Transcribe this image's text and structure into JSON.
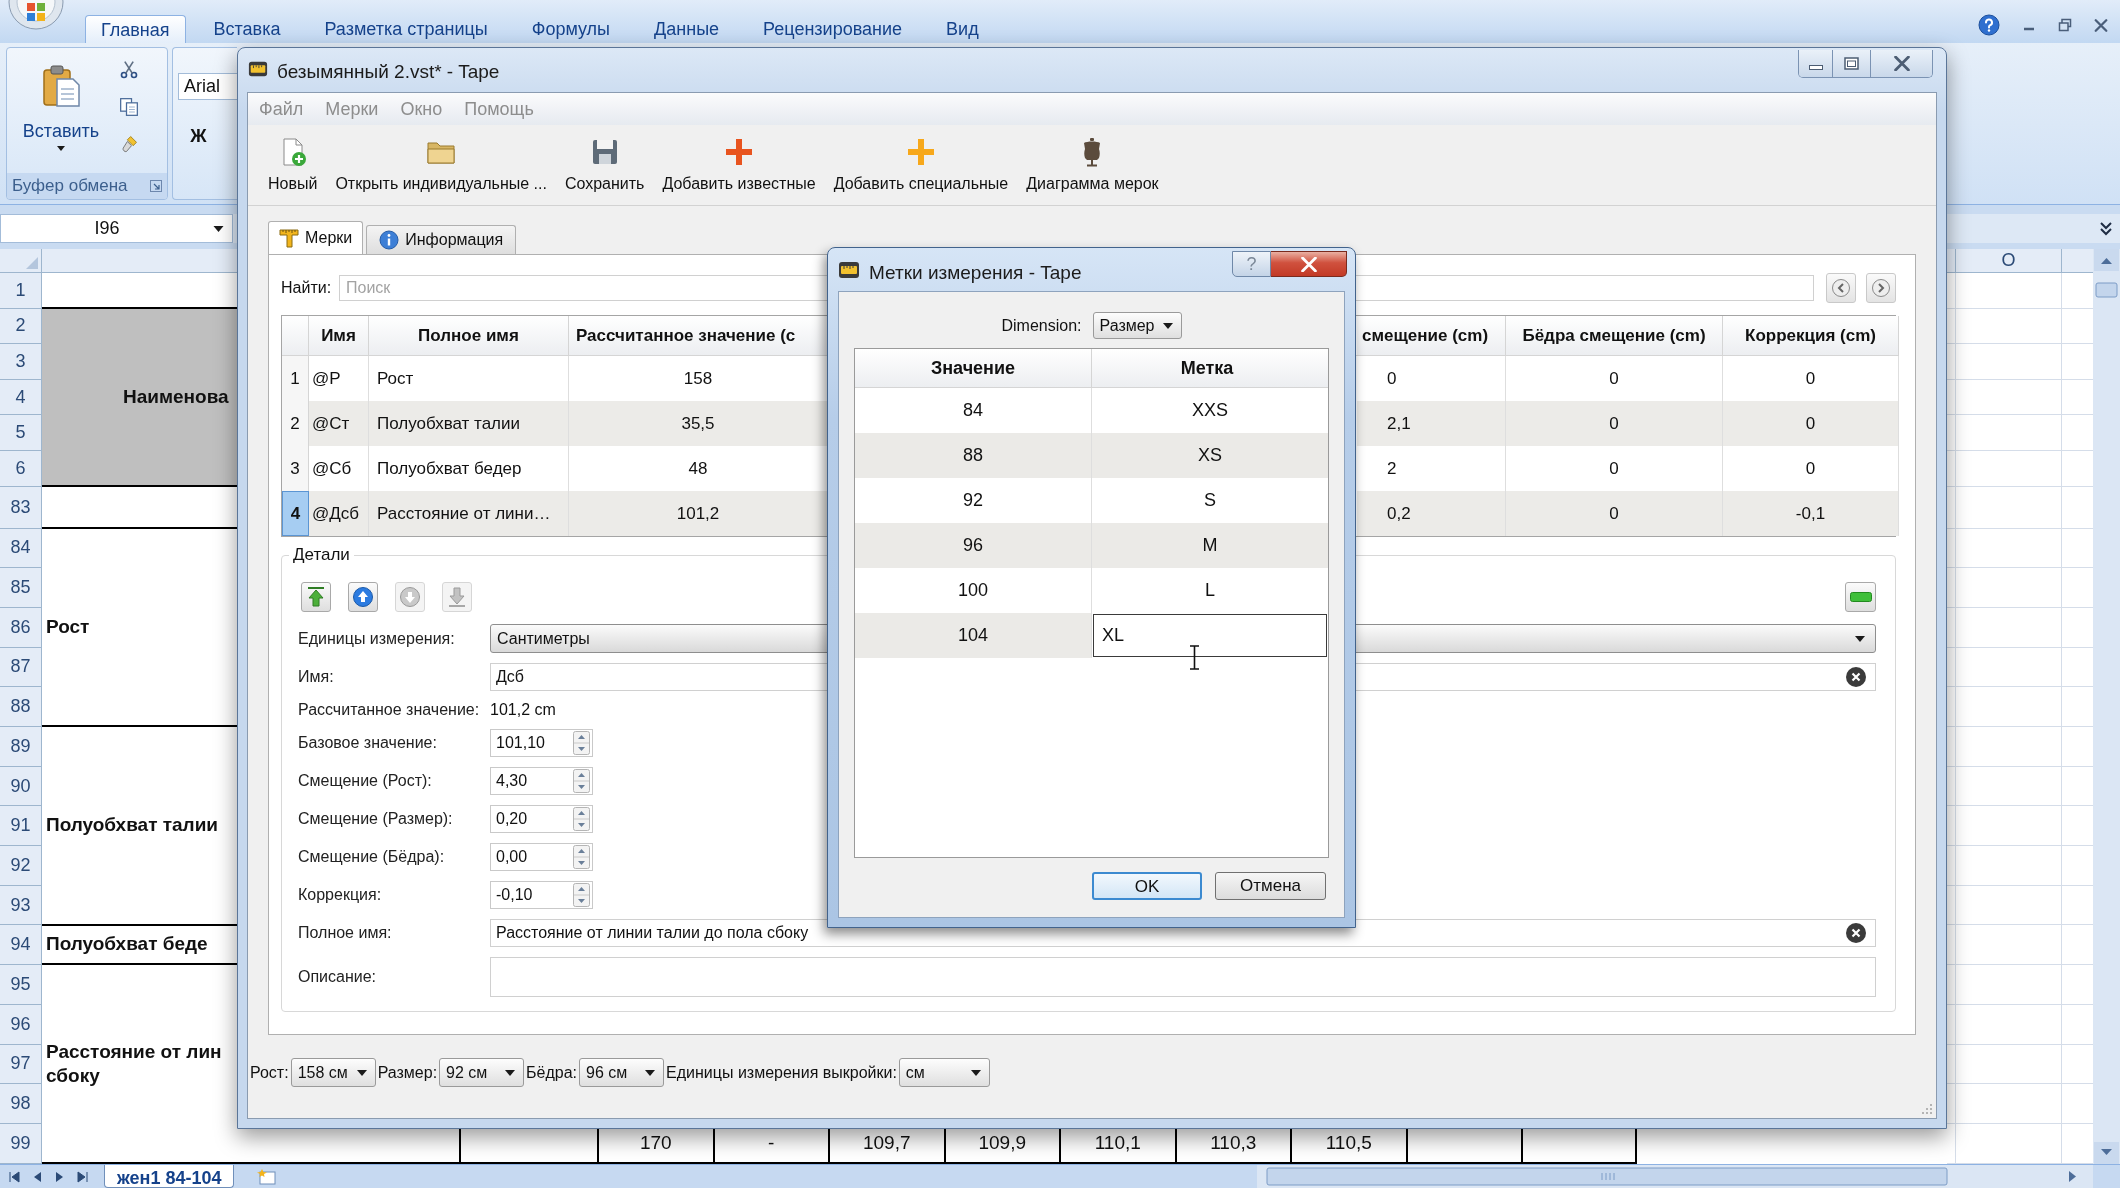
{
  "excel": {
    "ribbon_tabs": [
      {
        "label": "Главная",
        "selected": true
      },
      {
        "label": "Вставка",
        "selected": false
      },
      {
        "label": "Разметка страницы",
        "selected": false
      },
      {
        "label": "Формулы",
        "selected": false
      },
      {
        "label": "Данные",
        "selected": false
      },
      {
        "label": "Рецензирование",
        "selected": false
      },
      {
        "label": "Вид",
        "selected": false
      }
    ],
    "clipboard_group": {
      "paste_label": "Вставить",
      "title": "Буфер обмена"
    },
    "font_group": {
      "font_name": "Arial",
      "bold_label": "Ж"
    },
    "name_box": "I96",
    "column_header": "O",
    "row_groups": [
      {
        "rows": [
          "1"
        ],
        "shaded": false
      },
      {
        "rows": [
          "2",
          "3",
          "4",
          "5",
          "6"
        ],
        "lines": [
          "Наименова"
        ],
        "shaded": true
      },
      {
        "rows": [
          "83"
        ],
        "shaded": false
      },
      {
        "rows": [
          "84",
          "85",
          "86",
          "87",
          "88"
        ],
        "lines": [
          "Рост"
        ],
        "shaded": false
      },
      {
        "rows": [
          "89",
          "90",
          "91",
          "92",
          "93"
        ],
        "lines": [
          "Полуобхват талии"
        ],
        "shaded": false
      },
      {
        "rows": [
          "94"
        ],
        "lines": [
          "Полуобхват беде"
        ],
        "shaded": false
      },
      {
        "rows": [
          "95",
          "96",
          "97",
          "98",
          "99"
        ],
        "lines": [
          "Расстояние от лин",
          "сбоку"
        ],
        "shaded": false
      }
    ],
    "bottom_row_values": [
      "170",
      "-",
      "109,7",
      "109,9",
      "110,1",
      "110,3",
      "110,5"
    ],
    "sheet_tabs": [
      {
        "label": "жен1 84-104",
        "selected": true
      }
    ]
  },
  "tape": {
    "title": "безымянный 2.vst* - Tape",
    "menu": [
      {
        "label": "Файл",
        "disabled": true
      },
      {
        "label": "Мерки",
        "disabled": true
      },
      {
        "label": "Окно",
        "disabled": true
      },
      {
        "label": "Помощь",
        "disabled": true
      }
    ],
    "toolbar": [
      {
        "kind": "new",
        "label": "Новый"
      },
      {
        "kind": "open",
        "label": "Открыть индивидуальные ..."
      },
      {
        "kind": "save",
        "label": "Сохранить"
      },
      {
        "kind": "add_known",
        "label": "Добавить известные"
      },
      {
        "kind": "add_custom",
        "label": "Добавить специальные"
      },
      {
        "kind": "diagram",
        "label": "Диаграмма мерок"
      }
    ],
    "tabs": [
      {
        "kind": "measurements",
        "label": "Мерки",
        "selected": true
      },
      {
        "kind": "info",
        "label": "Информация",
        "selected": false
      }
    ],
    "search": {
      "label": "Найти:",
      "placeholder": "Поиск"
    },
    "table": {
      "columns": [
        "Имя",
        "Полное имя",
        "Рассчитанное значение (c",
        "смещение (cm)",
        "Бёдра смещение (cm)",
        "Коррекция (cm)"
      ],
      "rows": [
        {
          "number": "1",
          "selected": false,
          "cells": [
            "@Р",
            "Рост",
            "158",
            "0",
            "0",
            "0"
          ]
        },
        {
          "number": "2",
          "selected": false,
          "cells": [
            "@Ст",
            "Полуобхват талии",
            "35,5",
            "2,1",
            "0",
            "0"
          ]
        },
        {
          "number": "3",
          "selected": false,
          "cells": [
            "@Сб",
            "Полуобхват бедер",
            "48",
            "2",
            "0",
            "0"
          ]
        },
        {
          "number": "4",
          "selected": true,
          "cells": [
            "@Дсб",
            "Расстояние от лини…",
            "101,2",
            "0,2",
            "0",
            "-0,1"
          ]
        }
      ]
    },
    "details": {
      "title": "Детали",
      "move_buttons": [
        {
          "kind": "top",
          "disabled": false
        },
        {
          "kind": "up",
          "disabled": false
        },
        {
          "kind": "down",
          "disabled": true
        },
        {
          "kind": "bottom",
          "disabled": true
        }
      ],
      "fields": [
        {
          "kind": "combo",
          "label": "Единицы измерения:",
          "value": "Сантиметры"
        },
        {
          "kind": "line",
          "label": "Имя:",
          "value": "Дсб"
        },
        {
          "kind": "text",
          "label": "Рассчитанное значение:",
          "value": "101,2 cm"
        },
        {
          "kind": "spin",
          "label": "Базовое значение:",
          "value": "101,10"
        },
        {
          "kind": "spin",
          "label": "Смещение (Рост):",
          "value": "4,30"
        },
        {
          "kind": "spin",
          "label": "Смещение (Размер):",
          "value": "0,20"
        },
        {
          "kind": "spin",
          "label": "Смещение (Бёдра):",
          "value": "0,00"
        },
        {
          "kind": "spin",
          "label": "Коррекция:",
          "value": "-0,10"
        },
        {
          "kind": "line",
          "label": "Полное имя:",
          "value": "Расстояние от линии талии до пола сбоку"
        },
        {
          "kind": "textarea",
          "label": "Описание:"
        }
      ]
    },
    "status_bar": [
      {
        "label": "Рост:",
        "value": "158 см"
      },
      {
        "label": "Размер:",
        "value": "92 см"
      },
      {
        "label": "Бёдра:",
        "value": "96 см"
      },
      {
        "label": "Единицы измерения выкройки:",
        "value": "см"
      }
    ]
  },
  "dialog": {
    "title": "Метки измерения - Tape",
    "help_button": "?",
    "dimension": {
      "label": "Dimension:",
      "value": "Размер"
    },
    "columns": [
      "Значение",
      "Метка"
    ],
    "rows": [
      {
        "value": "84",
        "label": "XXS",
        "editing": false
      },
      {
        "value": "88",
        "label": "XS",
        "editing": false
      },
      {
        "value": "92",
        "label": "S",
        "editing": false
      },
      {
        "value": "96",
        "label": "M",
        "editing": false
      },
      {
        "value": "100",
        "label": "L",
        "editing": false
      },
      {
        "value": "104",
        "label": "XL",
        "editing": true
      }
    ],
    "buttons": [
      {
        "label": "OK",
        "default": true
      },
      {
        "label": "Отмена",
        "default": false
      }
    ]
  }
}
